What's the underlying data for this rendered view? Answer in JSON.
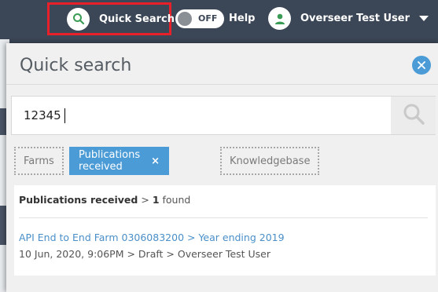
{
  "header": {
    "quick_search_label": "Quick Search",
    "toggle_label": "OFF",
    "help_label": "Help",
    "user_name": "Overseer Test User"
  },
  "panel": {
    "title": "Quick search",
    "search_value": "12345",
    "filters": [
      {
        "label": "Farms",
        "active": false
      },
      {
        "label": "Publications received",
        "active": true,
        "remove_symbol": "×"
      },
      {
        "label": "Knowledgebase",
        "active": false
      }
    ],
    "results": {
      "category": "Publications received",
      "separator": ">",
      "count": "1",
      "found_label": "found",
      "items": [
        {
          "title": "API End to End Farm 0306083200 > Year ending 2019",
          "meta": "10 Jun, 2020, 9:06PM > Draft > Overseer Test User"
        }
      ]
    }
  },
  "colors": {
    "topbar": "#3b4656",
    "accent": "#4a9bd6",
    "highlight": "#e8202a",
    "avatar_green": "#3a9b55",
    "search_green": "#3a9b55"
  },
  "icons": {
    "quick_search": "search-icon",
    "user": "user-icon",
    "close": "close-icon",
    "search_button": "search-icon",
    "user_menu": "caret-down-icon"
  }
}
